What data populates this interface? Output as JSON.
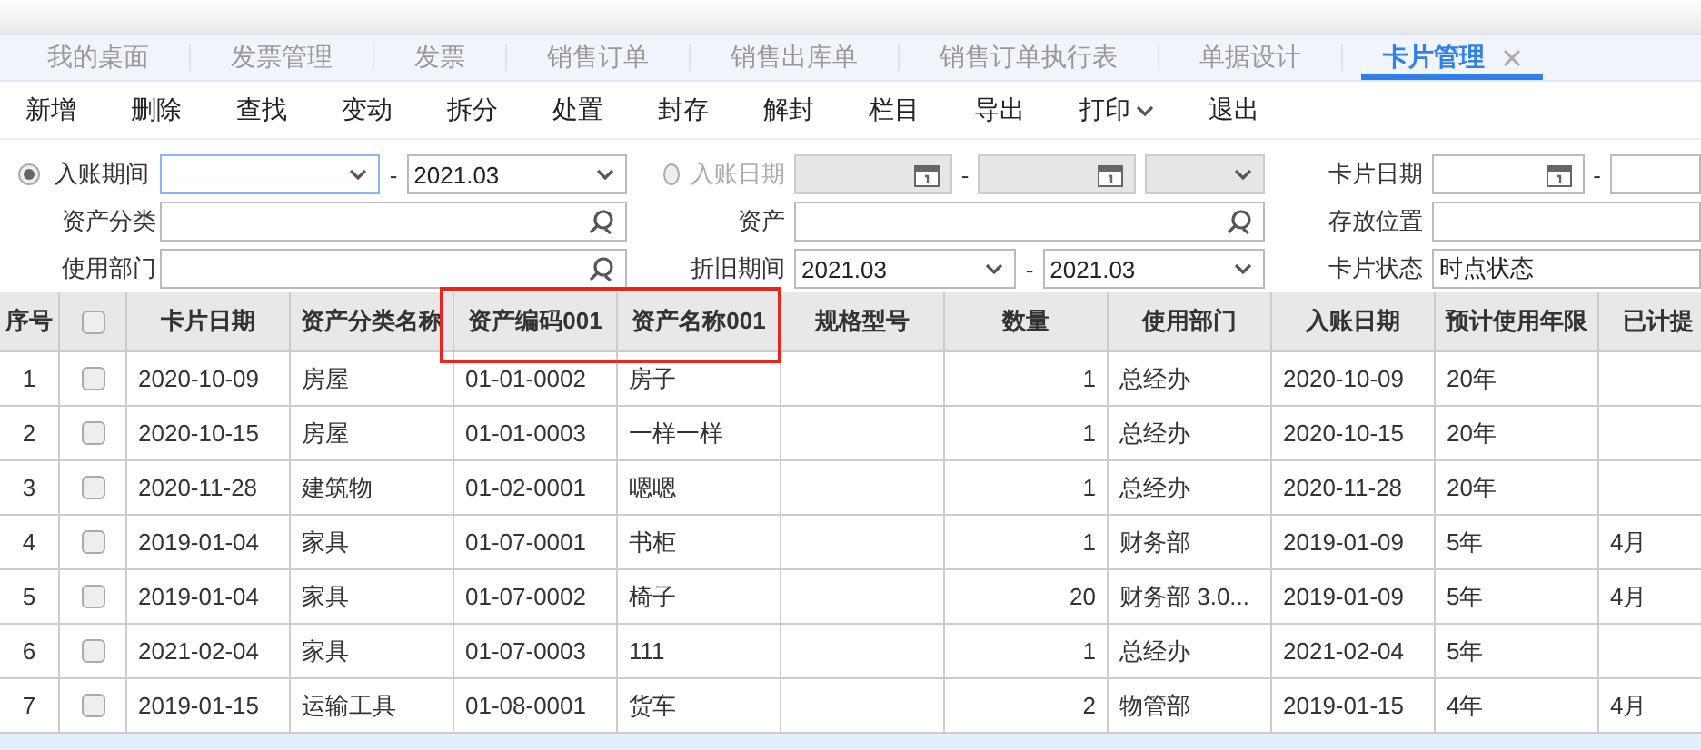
{
  "tabs": [
    {
      "label": "我的桌面",
      "selected": false
    },
    {
      "label": "发票管理",
      "selected": false
    },
    {
      "label": "发票",
      "selected": false
    },
    {
      "label": "销售订单",
      "selected": false
    },
    {
      "label": "销售出库单",
      "selected": false
    },
    {
      "label": "销售订单执行表",
      "selected": false
    },
    {
      "label": "单据设计",
      "selected": false
    },
    {
      "label": "卡片管理",
      "selected": true
    }
  ],
  "toolbar": [
    {
      "label": "新增",
      "kind": "button"
    },
    {
      "label": "删除",
      "kind": "button"
    },
    {
      "label": "查找",
      "kind": "button"
    },
    {
      "label": "变动",
      "kind": "button"
    },
    {
      "label": "拆分",
      "kind": "button"
    },
    {
      "label": "处置",
      "kind": "button"
    },
    {
      "label": "封存",
      "kind": "button"
    },
    {
      "label": "解封",
      "kind": "button"
    },
    {
      "label": "栏目",
      "kind": "button"
    },
    {
      "label": "导出",
      "kind": "button"
    },
    {
      "label": "打印",
      "kind": "dropdown"
    },
    {
      "label": "退出",
      "kind": "button"
    }
  ],
  "filters": {
    "period": {
      "label": "入账期间",
      "selected": true,
      "dash": "-",
      "to": "2021.03"
    },
    "entry_date": {
      "label": "入账日期",
      "selected": false,
      "disabled": true,
      "dash": "-"
    },
    "card_date": {
      "label": "卡片日期",
      "dash": "-"
    },
    "asset_category": {
      "label": "资产分类"
    },
    "asset": {
      "label": "资产"
    },
    "location": {
      "label": "存放位置"
    },
    "department": {
      "label": "使用部门"
    },
    "depreciation_period": {
      "label": "折旧期间",
      "from": "2021.03",
      "dash": "-",
      "to": "2021.03"
    },
    "card_status": {
      "label": "卡片状态",
      "value": "时点状态"
    }
  },
  "table": {
    "header_checked": false,
    "columns": [
      {
        "label": "序号",
        "kind": "index"
      },
      {
        "kind": "checkbox"
      },
      {
        "label": "卡片日期",
        "kind": "text"
      },
      {
        "label": "资产分类名称",
        "kind": "text"
      },
      {
        "label": "资产编码001",
        "kind": "text"
      },
      {
        "label": "资产名称001",
        "kind": "text"
      },
      {
        "label": "规格型号",
        "kind": "text"
      },
      {
        "label": "数量",
        "kind": "number"
      },
      {
        "label": "使用部门",
        "kind": "text"
      },
      {
        "label": "入账日期",
        "kind": "text"
      },
      {
        "label": "预计使用年限",
        "kind": "text"
      },
      {
        "label": "已计提",
        "kind": "text"
      }
    ],
    "rows": [
      {
        "checked": false,
        "cells": [
          "1",
          null,
          "2020-10-09",
          "房屋",
          "01-01-0002",
          "房子",
          null,
          "1",
          "总经办",
          "2020-10-09",
          "20年",
          null
        ]
      },
      {
        "checked": false,
        "cells": [
          "2",
          null,
          "2020-10-15",
          "房屋",
          "01-01-0003",
          "一样一样",
          null,
          "1",
          "总经办",
          "2020-10-15",
          "20年",
          null
        ]
      },
      {
        "checked": false,
        "cells": [
          "3",
          null,
          "2020-11-28",
          "建筑物",
          "01-02-0001",
          "嗯嗯",
          null,
          "1",
          "总经办",
          "2020-11-28",
          "20年",
          null
        ]
      },
      {
        "checked": false,
        "cells": [
          "4",
          null,
          "2019-01-04",
          "家具",
          "01-07-0001",
          "书柜",
          null,
          "1",
          "财务部",
          "2019-01-09",
          "5年",
          "4月"
        ]
      },
      {
        "checked": false,
        "cells": [
          "5",
          null,
          "2019-01-04",
          "家具",
          "01-07-0002",
          "椅子",
          null,
          "20",
          "财务部 3.0...",
          "2019-01-09",
          "5年",
          "4月"
        ]
      },
      {
        "checked": false,
        "cells": [
          "6",
          null,
          "2021-02-04",
          "家具",
          "01-07-0003",
          "111",
          null,
          "1",
          "总经办",
          "2021-02-04",
          "5年",
          null
        ]
      },
      {
        "checked": false,
        "cells": [
          "7",
          null,
          "2019-01-15",
          "运输工具",
          "01-08-0001",
          "货车",
          null,
          "2",
          "物管部",
          "2019-01-15",
          "4年",
          "4月"
        ]
      }
    ]
  }
}
